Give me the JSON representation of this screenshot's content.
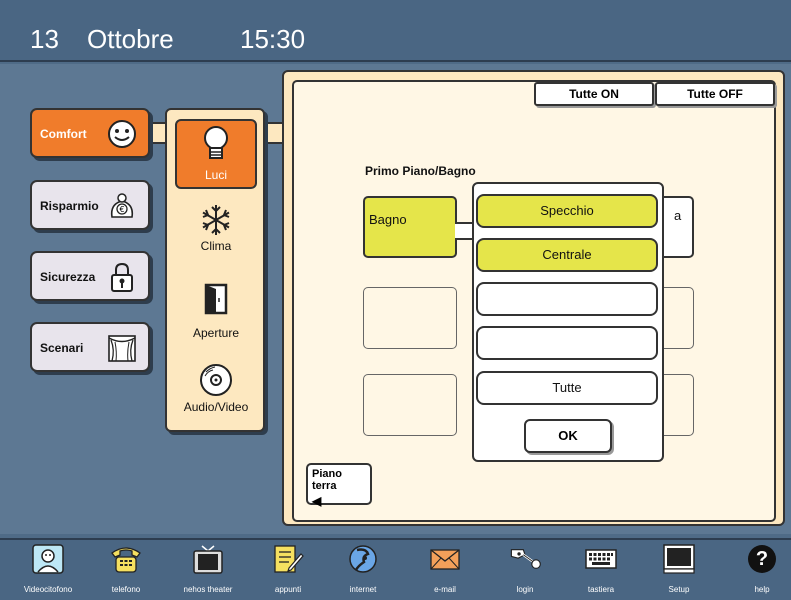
{
  "header": {
    "day": "13",
    "month": "Ottobre",
    "time": "15:30"
  },
  "categories": [
    {
      "label": "Comfort",
      "icon": "smiley-icon",
      "active": true
    },
    {
      "label": "Risparmio",
      "icon": "piggy-bank-icon",
      "active": false
    },
    {
      "label": "Sicurezza",
      "icon": "padlock-icon",
      "active": false
    },
    {
      "label": "Scenari",
      "icon": "theater-curtain-icon",
      "active": false
    }
  ],
  "subcategories": [
    {
      "label": "Luci",
      "icon": "light-bulb-icon",
      "active": true
    },
    {
      "label": "Clima",
      "icon": "snowflake-icon",
      "active": false
    },
    {
      "label": "Aperture",
      "icon": "door-icon",
      "active": false
    },
    {
      "label": "Audio/Video",
      "icon": "cd-icon",
      "active": false
    }
  ],
  "panel": {
    "all_on": "Tutte ON",
    "all_off": "Tutte OFF",
    "section_title": "Primo Piano/Bagno",
    "tile_bagno": "Bagno",
    "tile_partial": "a",
    "floor_button": "Piano terra",
    "floor_arrow": "◀"
  },
  "popup": {
    "items": [
      "Specchio",
      "Centrale",
      "",
      "",
      "Tutte"
    ],
    "ok": "OK"
  },
  "bottom": [
    {
      "label": "Videocitofono",
      "icon": "videophone-icon"
    },
    {
      "label": "telefono",
      "icon": "telephone-icon"
    },
    {
      "label": "nehos theater",
      "icon": "tv-icon"
    },
    {
      "label": "appunti",
      "icon": "notepad-icon"
    },
    {
      "label": "internet",
      "icon": "globe-icon"
    },
    {
      "label": "e-mail",
      "icon": "envelope-icon"
    },
    {
      "label": "login",
      "icon": "key-icon"
    },
    {
      "label": "tastiera",
      "icon": "keyboard-icon"
    },
    {
      "label": "Setup",
      "icon": "monitor-icon"
    },
    {
      "label": "help",
      "icon": "help-icon",
      "glyph": "?"
    }
  ],
  "colors": {
    "active_orange": "#f07c2b",
    "panel_cream": "#fde8c0",
    "light_on": "#e5e54a",
    "bg_blue": "#4f6b87"
  }
}
